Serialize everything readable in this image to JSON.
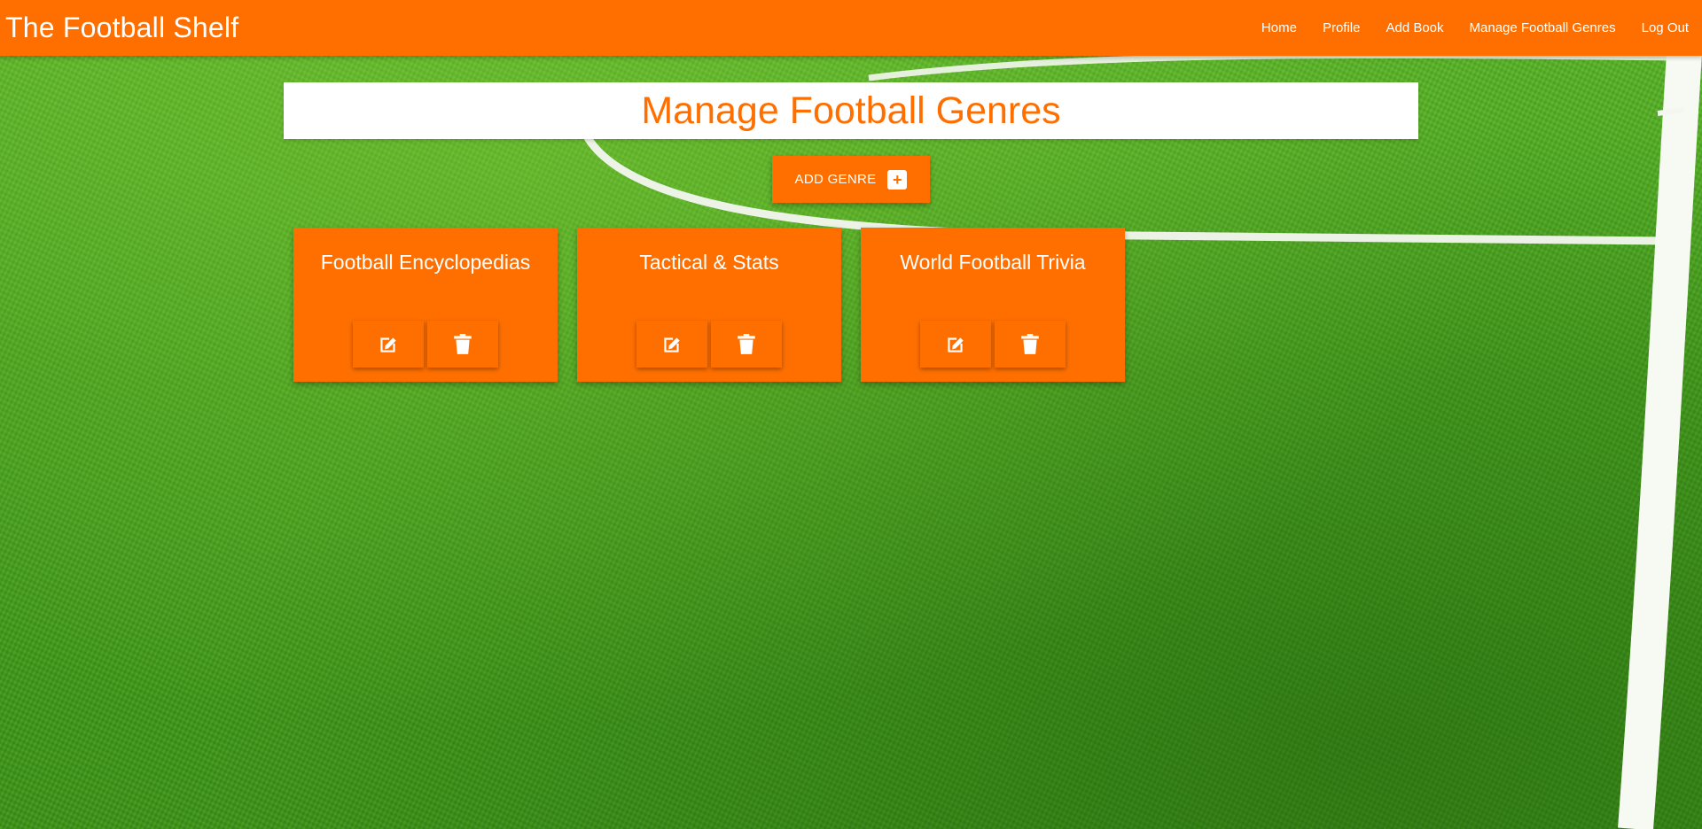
{
  "navbar": {
    "brand": "The Football Shelf",
    "links": [
      {
        "label": "Home"
      },
      {
        "label": "Profile"
      },
      {
        "label": "Add Book"
      },
      {
        "label": "Manage Football Genres"
      },
      {
        "label": "Log Out"
      }
    ]
  },
  "main": {
    "title": "Manage Football Genres",
    "add_button": {
      "label": "ADD GENRE",
      "icon": "plus-square-icon"
    },
    "genres": [
      {
        "name": "Football Encyclopedias",
        "edit_icon": "edit-icon",
        "delete_icon": "trash-icon"
      },
      {
        "name": "Tactical & Stats",
        "edit_icon": "edit-icon",
        "delete_icon": "trash-icon"
      },
      {
        "name": "World Football Trivia",
        "edit_icon": "edit-icon",
        "delete_icon": "trash-icon"
      }
    ]
  },
  "colors": {
    "accent": "#ff6f00",
    "text_light": "#ffffff",
    "panel": "#ffffff"
  }
}
